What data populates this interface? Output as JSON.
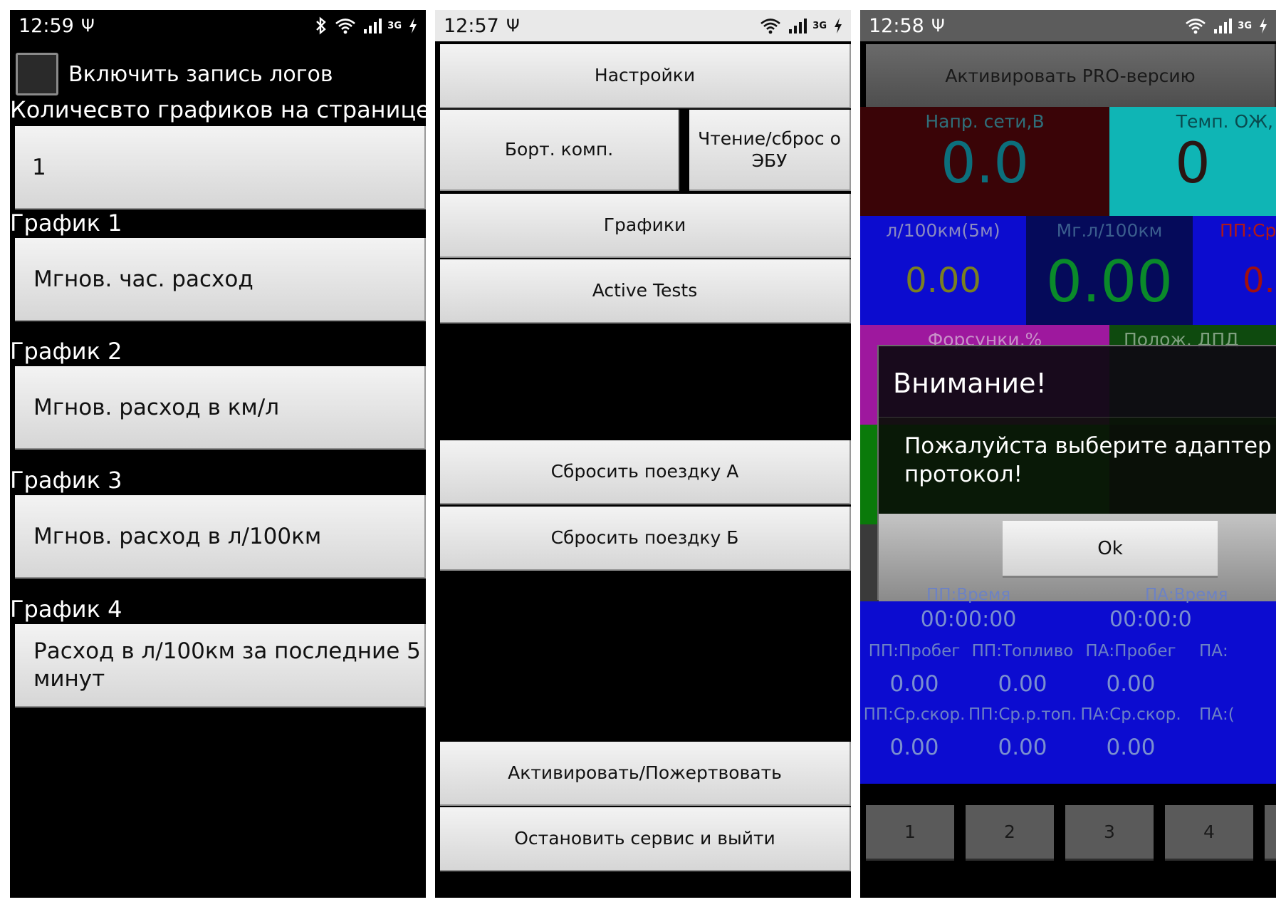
{
  "phone1": {
    "status": {
      "time": "12:59"
    },
    "enable_logging": {
      "label": "Включить запись логов",
      "checked": false
    },
    "charts_count": {
      "label": "Количесвто графиков на странице:",
      "value": "1"
    },
    "charts": [
      {
        "label": "График 1",
        "value": "Мгнов. час. расход"
      },
      {
        "label": "График 2",
        "value": "Мгнов. расход в км/л"
      },
      {
        "label": "График 3",
        "value": "Мгнов. расход в л/100км"
      },
      {
        "label": "График 4",
        "value": "Расход в л/100км за последние 5 минут"
      }
    ]
  },
  "phone2": {
    "status": {
      "time": "12:57"
    },
    "buttons": {
      "settings": "Настройки",
      "trip_computer": "Борт. комп.",
      "read_reset_ecu": "Чтение/сброс о ЭБУ",
      "charts": "Графики",
      "active_tests": "Active Tests",
      "reset_trip_a": "Сбросить поездку А",
      "reset_trip_b": "Сбросить поездку Б",
      "activate_donate": "Активировать/Пожертвовать",
      "stop_service_exit": "Остановить сервис и выйти"
    }
  },
  "phone3": {
    "status": {
      "time": "12:58"
    },
    "activate_pro": "Активировать PRO-версию",
    "tiles": {
      "voltage": {
        "label": "Напр. сети,В",
        "value": "0.0"
      },
      "coolant_temp": {
        "label": "Темп. ОЖ,",
        "value": "0"
      },
      "consumption_5m": {
        "label": "л/100км(5м)",
        "value": "0.00"
      },
      "instant_consumption": {
        "label": "Мг.л/100км",
        "value": "0.00"
      },
      "trip_avg_partial": {
        "label": "ПП:Ср",
        "value": "0."
      },
      "injectors": {
        "label": "Форсунки,%"
      },
      "throttle": {
        "label": "Полож. ДПД"
      }
    },
    "trip_b": {
      "time_label": "ПП:Время",
      "time_value": "00:00:00",
      "distance_label": "ПП:Пробег",
      "distance_value": "0.00",
      "fuel_label": "ПП:Топливо",
      "fuel_value": "0.00",
      "avg_speed_label": "ПП:Ср.скор.",
      "avg_speed_value": "0.00",
      "avg_fuel_label": "ПП:Ср.р.топ.",
      "avg_fuel_value": "0.00"
    },
    "trip_a": {
      "time_label": "ПА:Время",
      "time_value": "00:00:0",
      "distance_label": "ПА:Пробег",
      "distance_value": "0.00",
      "fuel_label": "ПА:",
      "avg_speed_label": "ПА:Ср.скор.",
      "avg_speed_value": "0.00",
      "avg_fuel_label": "ПА:("
    },
    "pages": [
      "1",
      "2",
      "3",
      "4"
    ],
    "dialog": {
      "title": "Внимание!",
      "message": "Пожалуйста выберите адаптер протокол!",
      "ok": "Ok"
    }
  }
}
